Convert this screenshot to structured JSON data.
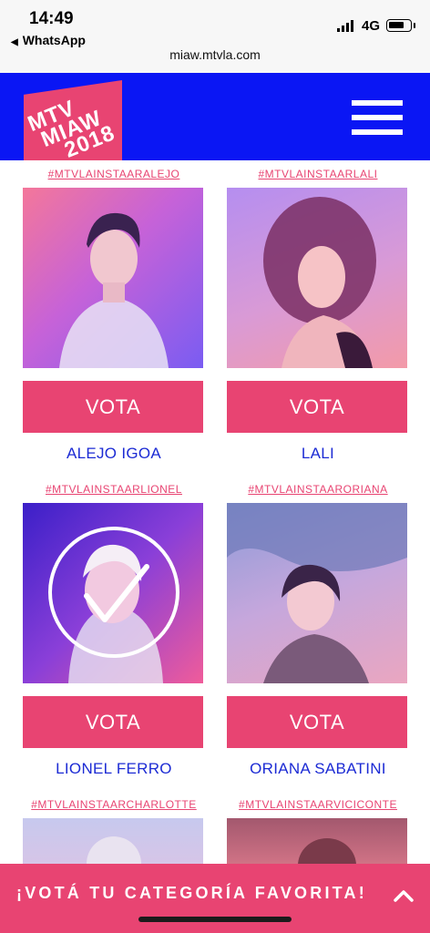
{
  "statusbar": {
    "time": "14:49",
    "back_app": "WhatsApp",
    "network": "4G",
    "battery_level": 0.75,
    "url": "miaw.mtvla.com"
  },
  "header": {
    "logo_lines": [
      "MTV",
      "MIAW",
      "2018"
    ],
    "menu_icon": "hamburger-icon",
    "brand_color": "#0a16f4"
  },
  "accent_color": "#e84472",
  "cards": [
    {
      "tag": "#MTVLAINSTAARALEJO",
      "vote_label": "VOTA",
      "name": "ALEJO IGOA",
      "selected": false
    },
    {
      "tag": "#MTVLAINSTAARLALI",
      "vote_label": "VOTA",
      "name": "LALI",
      "selected": false
    },
    {
      "tag": "#MTVLAINSTAARLIONEL",
      "vote_label": "VOTA",
      "name": "LIONEL FERRO",
      "selected": true
    },
    {
      "tag": "#MTVLAINSTAARORIANA",
      "vote_label": "VOTA",
      "name": "ORIANA SABATINI",
      "selected": false
    },
    {
      "tag": "#MTVLAINSTAARCHARLOTTE"
    },
    {
      "tag": "#MTVLAINSTAARVICICONTE"
    }
  ],
  "footer": {
    "label": "¡VOTÁ TU CATEGORÍA FAVORITA!",
    "icon": "chevron-up-icon"
  }
}
